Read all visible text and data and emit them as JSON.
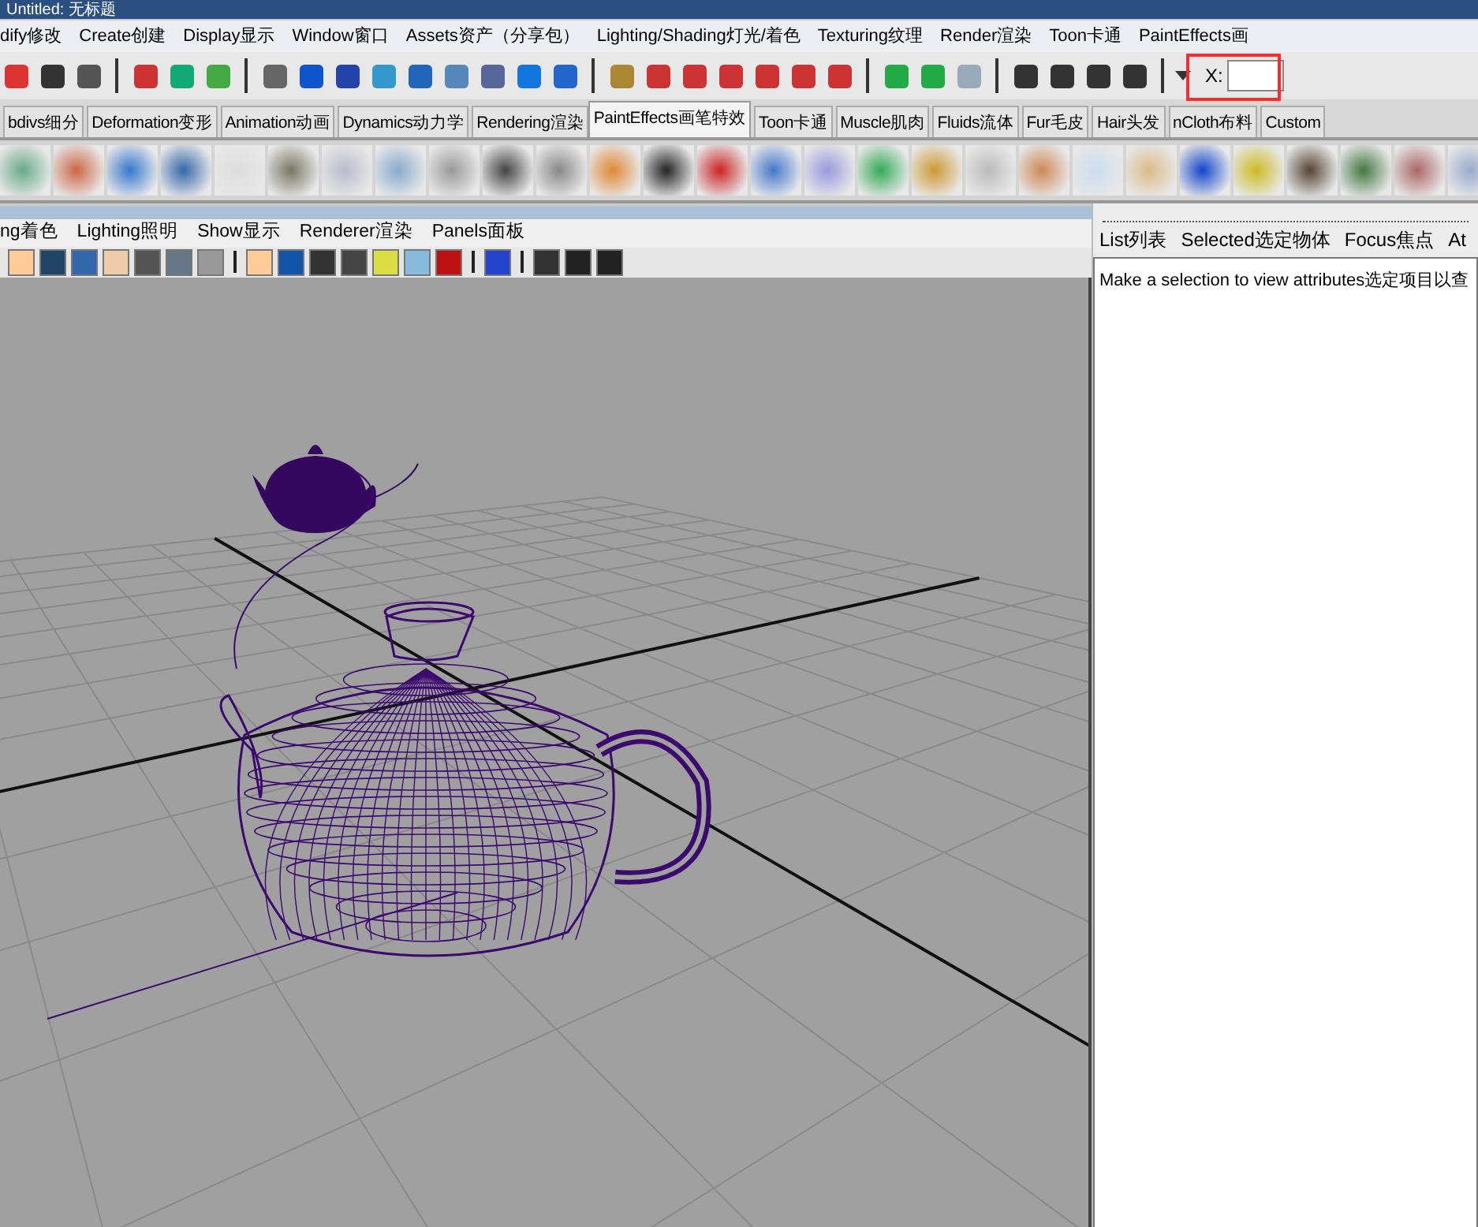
{
  "window": {
    "title": "Untitled: 无标题"
  },
  "menu_bar": [
    "dify修改",
    "Create创建",
    "Display显示",
    "Window窗口",
    "Assets资产（分享包）",
    "Lighting/Shading灯光/着色",
    "Texturing纹理",
    "Render渲染",
    "Toon卡通",
    "PaintEffects画"
  ],
  "status_line": {
    "x_label": "X:"
  },
  "shelf_tabs": [
    {
      "label": "bdivs细分",
      "selected": false
    },
    {
      "label": "Deformation变形",
      "selected": false
    },
    {
      "label": "Animation动画",
      "selected": false
    },
    {
      "label": "Dynamics动力学",
      "selected": false
    },
    {
      "label": "Rendering渲染",
      "selected": false
    },
    {
      "label": "PaintEffects画笔特效",
      "selected": true
    },
    {
      "label": "Toon卡通",
      "selected": false
    },
    {
      "label": "Muscle肌肉",
      "selected": false
    },
    {
      "label": "Fluids流体",
      "selected": false
    },
    {
      "label": "Fur毛皮",
      "selected": false
    },
    {
      "label": "Hair头发",
      "selected": false
    },
    {
      "label": "nCloth布料",
      "selected": false
    },
    {
      "label": "Custom",
      "selected": false
    }
  ],
  "panel_menu": [
    "ng着色",
    "Lighting照明",
    "Show显示",
    "Renderer渲染",
    "Panels面板"
  ],
  "attribute_editor": {
    "tabs": [
      "List列表",
      "Selected选定物体",
      "Focus焦点",
      "At"
    ],
    "message": "Make a selection to view attributes选定项目以查"
  }
}
